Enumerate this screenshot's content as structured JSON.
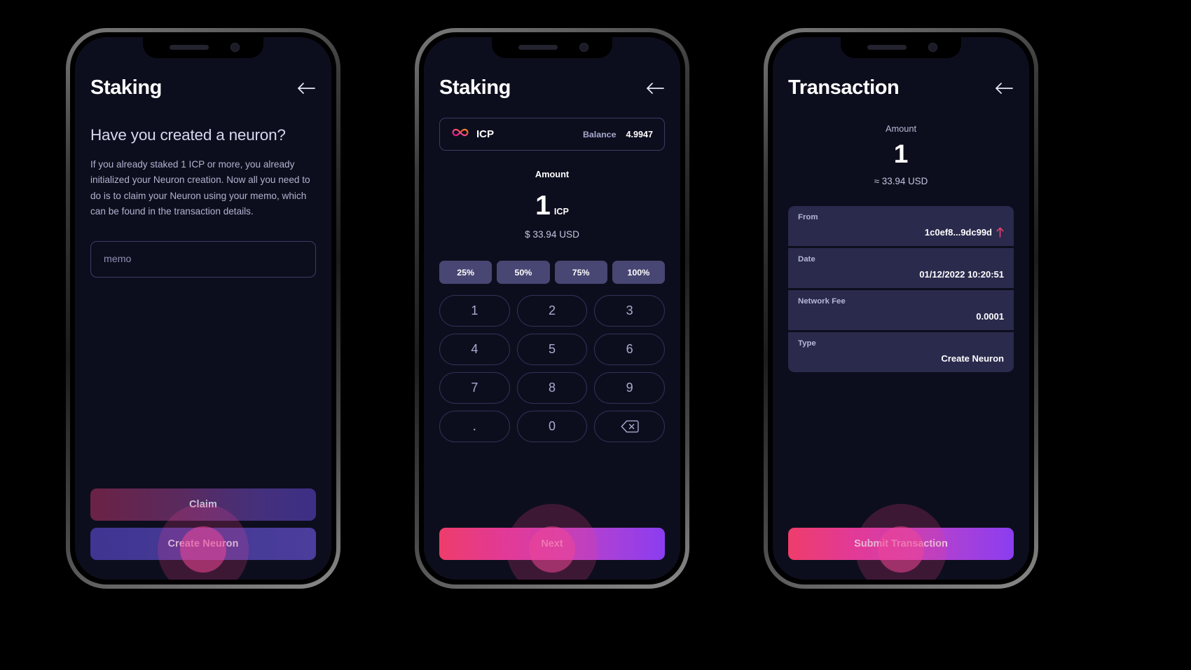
{
  "screens": [
    {
      "title": "Staking",
      "question": "Have you created a neuron?",
      "body": "If you already staked  1 ICP or more, you already initialized your Neuron creation. Now all you need to do is to claim your Neuron using your memo, which can be found in the transaction details.",
      "memo_placeholder": "memo",
      "primary_button": "Claim",
      "secondary_button": "Create Neuron"
    },
    {
      "title": "Staking",
      "token": {
        "symbol": "ICP",
        "balance_label": "Balance",
        "balance_value": "4.9947",
        "icon": "icp-infinity-icon"
      },
      "amount_label": "Amount",
      "amount_value": "1",
      "amount_unit": "ICP",
      "amount_usd": "$ 33.94 USD",
      "percent_buttons": [
        "25%",
        "50%",
        "75%",
        "100%"
      ],
      "keypad": [
        "1",
        "2",
        "3",
        "4",
        "5",
        "6",
        "7",
        "8",
        "9",
        ".",
        "0",
        "backspace-icon"
      ],
      "submit_button": "Next"
    },
    {
      "title": "Transaction",
      "amount_label": "Amount",
      "amount_value": "1",
      "amount_usd": "≈ 33.94 USD",
      "rows": [
        {
          "key": "From",
          "value": "1c0ef8...9dc99d",
          "icon": "outgoing-arrow-icon"
        },
        {
          "key": "Date",
          "value": "01/12/2022 10:20:51",
          "icon": ""
        },
        {
          "key": "Network Fee",
          "value": "0.0001",
          "icon": ""
        },
        {
          "key": "Type",
          "value": "Create Neuron",
          "icon": ""
        }
      ],
      "submit_button": "Submit Transaction"
    }
  ],
  "icons": {
    "back": "back-arrow-icon",
    "notch_speaker": "speaker-grille-icon",
    "notch_camera": "front-camera-icon"
  },
  "colors": {
    "screen_bg": "#0d0e1d",
    "accent_pink": "#ee3d6b",
    "accent_purple": "#8b3df0",
    "card_bg": "#2a2a4d",
    "pct_bg": "#484673",
    "border": "#3e3a66",
    "muted_text": "#b0b3cf",
    "outgoing_arrow": "#ef4472"
  }
}
